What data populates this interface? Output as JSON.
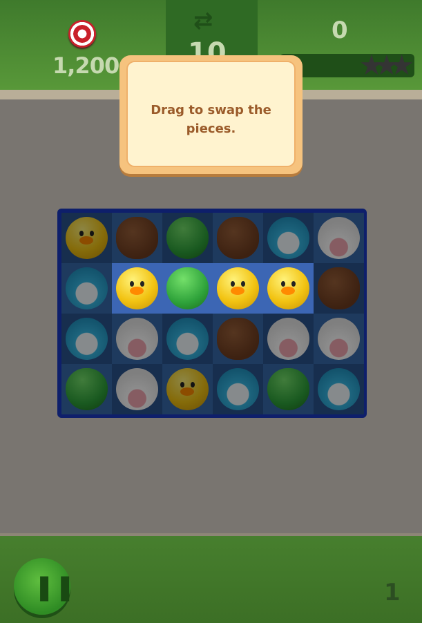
{
  "hud": {
    "target_score": "1,200",
    "moves_left": "10",
    "score": "0",
    "stars_earned": 0,
    "stars_total": 3
  },
  "tutorial": {
    "message": "Drag to swap the pieces."
  },
  "board": {
    "rows": 4,
    "cols": 6,
    "pieces": [
      [
        "yellow-chick",
        "brown-bear",
        "green-frog",
        "brown-bear",
        "blue-penguin",
        "cow"
      ],
      [
        "blue-penguin",
        "yellow-chick",
        "green-frog",
        "yellow-chick",
        "yellow-chick",
        "brown-bear"
      ],
      [
        "blue-penguin",
        "cow",
        "blue-penguin",
        "brown-bear",
        "cow",
        "cow"
      ],
      [
        "green-frog",
        "cow",
        "yellow-chick",
        "blue-penguin",
        "green-frog",
        "blue-penguin"
      ]
    ],
    "highlighted_row": 1,
    "highlighted_cols": [
      1,
      2,
      3,
      4
    ]
  },
  "footer": {
    "level_number": "1",
    "pause_icon": "pause-icon"
  },
  "colors": {
    "hud_green": "#3f7a2c",
    "board_blue": "#0e1f6b",
    "highlight": "#3c66b4",
    "tutorial_bg": "#fff3cf",
    "tutorial_text": "#9b5b2a"
  }
}
